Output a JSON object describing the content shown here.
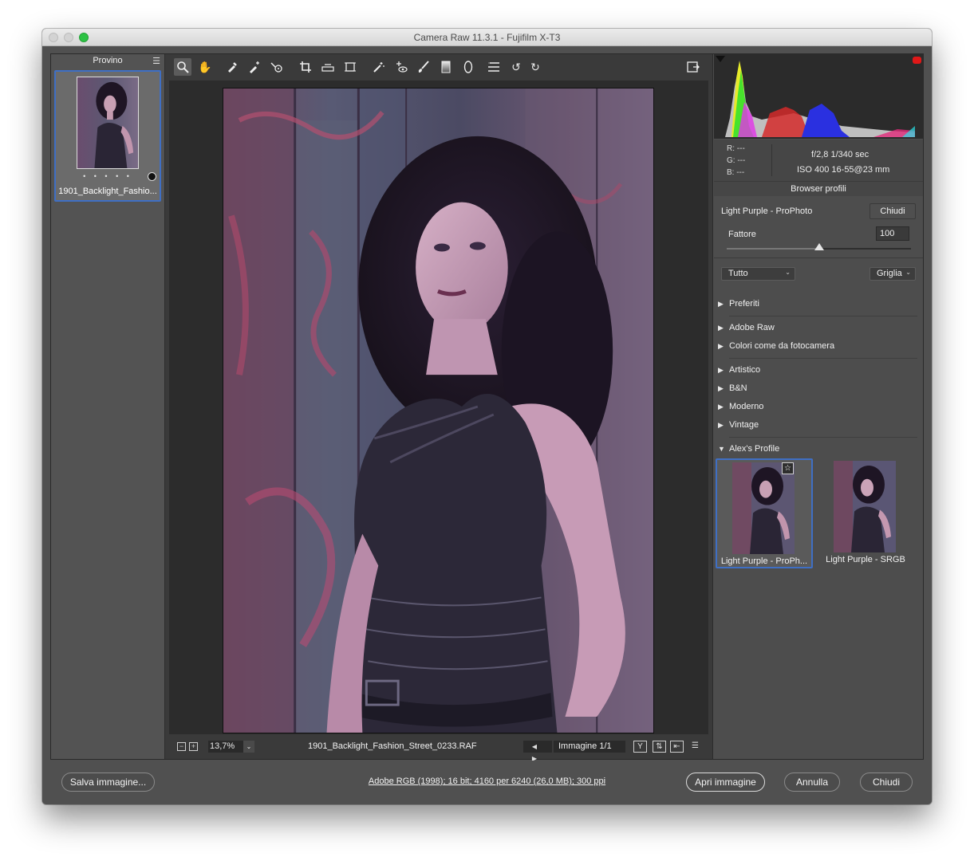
{
  "window": {
    "title": "Camera Raw 11.3.1  -  Fujifilm X-T3"
  },
  "filmstrip": {
    "title": "Provino",
    "menu_icon": "menu-lines-icon",
    "thumb_dots": "• • • • •",
    "thumb_name": "1901_Backlight_Fashio..."
  },
  "toolbar": {
    "tools": [
      "zoom-tool-icon",
      "hand-tool-icon",
      "white-balance-icon",
      "color-sampler-icon",
      "targeted-adjustment-icon",
      "crop-icon",
      "straighten-icon",
      "transform-icon",
      "spot-removal-icon",
      "red-eye-icon",
      "adjustment-brush-icon",
      "graduated-filter-icon",
      "radial-filter-icon",
      "preferences-icon",
      "rotate-left-icon",
      "rotate-right-icon"
    ],
    "fullscreen_icon": "fullscreen-icon"
  },
  "statusbar": {
    "zoom_minus": "−",
    "zoom_plus": "+",
    "zoom_value": "13,7%",
    "zoom_caret": "⌄",
    "filename": "1901_Backlight_Fashion_Street_0233.RAF",
    "nav_arrows": "◀ ▶",
    "image_count": "Immagine 1/1",
    "icons": [
      "Y",
      "⇅",
      "⇤",
      "☰"
    ]
  },
  "info": {
    "r": "R:   ---",
    "g": "G:   ---",
    "b": "B:   ---",
    "aperture_shutter": "f/2,8    1/340 sec",
    "iso_lens": "ISO 400    16-55@23 mm"
  },
  "profile_browser": {
    "title": "Browser profili",
    "current_profile": "Light Purple - ProPhoto",
    "close_label": "Chiudi",
    "amount_label": "Fattore",
    "amount_value": "100",
    "amount_fraction": 0.5,
    "filter_select": "Tutto",
    "view_select": "Griglia",
    "groups": [
      {
        "label": "Preferiti",
        "open": false
      },
      {
        "label": "Adobe Raw",
        "open": false
      },
      {
        "label": "Colori come da fotocamera",
        "open": false
      },
      {
        "label": "Artistico",
        "open": false
      },
      {
        "label": "B&N",
        "open": false
      },
      {
        "label": "Moderno",
        "open": false
      },
      {
        "label": "Vintage",
        "open": false
      },
      {
        "label": "Alex's Profile",
        "open": true
      }
    ],
    "profiles": [
      {
        "label": "Light Purple - ProPh...",
        "selected": true
      },
      {
        "label": "Light Purple - SRGB",
        "selected": false
      }
    ],
    "star_icon": "☆"
  },
  "bottombar": {
    "save_label": "Salva immagine...",
    "workflow_text": "Adobe RGB (1998); 16 bit; 4160 per 6240 (26,0 MB); 300 ppi",
    "open_label": "Apri immagine",
    "cancel_label": "Annulla",
    "close_label": "Chiudi"
  },
  "colors": {
    "accent": "#3f6fc4",
    "traffic_green": "#2dc244"
  }
}
